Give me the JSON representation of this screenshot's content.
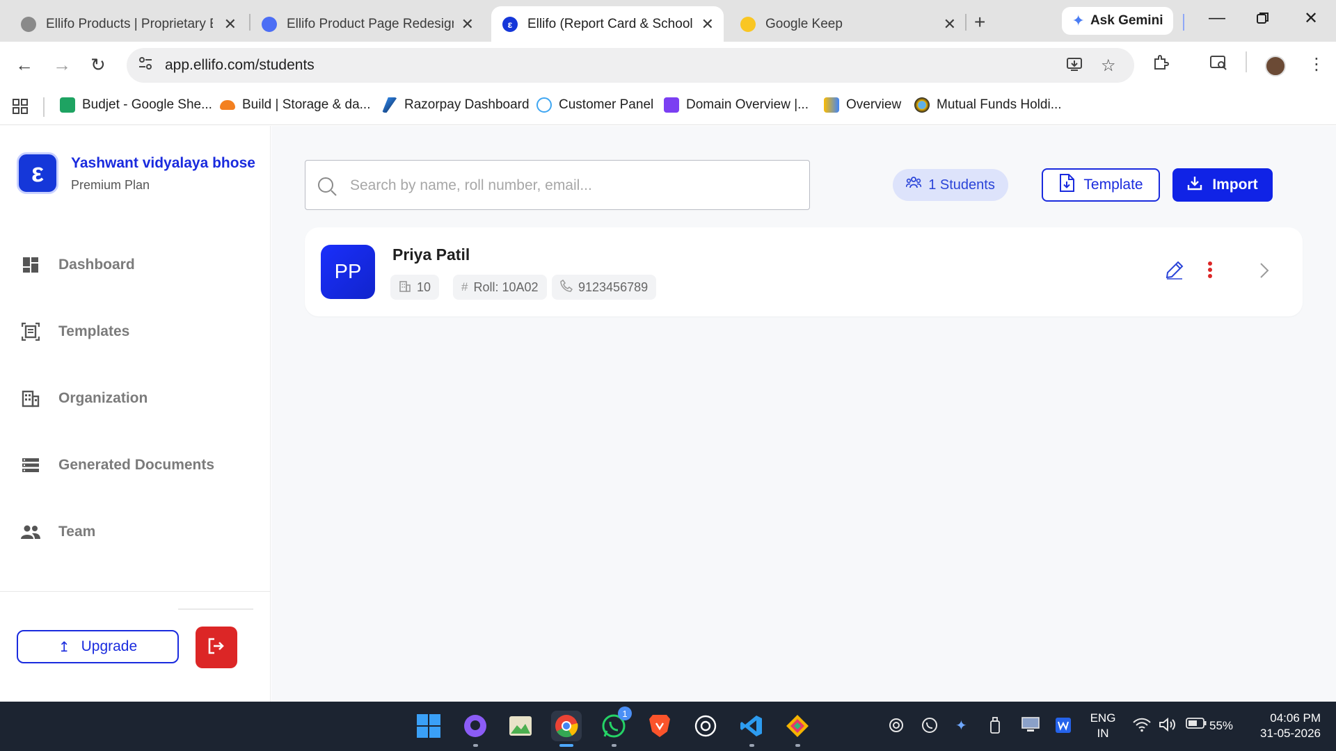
{
  "browser": {
    "tabs": [
      {
        "title": "Ellifo Products | Proprietary En",
        "active": false
      },
      {
        "title": "Ellifo Product Page Redesign -",
        "active": false
      },
      {
        "title": "Ellifo (Report Card & School E",
        "active": true
      },
      {
        "title": "Google Keep",
        "active": false
      }
    ],
    "new_tab": "+",
    "gemini_label": "Ask Gemini",
    "url": "app.ellifo.com/students",
    "bookmarks": [
      {
        "label": "Budjet - Google She...",
        "color": "#1ea362"
      },
      {
        "label": "Build | Storage & da...",
        "color": "#f38020"
      },
      {
        "label": "Razorpay Dashboard",
        "color": "#0c2451"
      },
      {
        "label": "Customer Panel",
        "color": "#3ea6f2"
      },
      {
        "label": "Domain Overview |...",
        "color": "#7b3ff2"
      },
      {
        "label": "Overview",
        "color": "#4285f4"
      },
      {
        "label": "Mutual Funds Holdi...",
        "color": "#222222"
      }
    ]
  },
  "sidebar": {
    "brand_name": "Yashwant vidyalaya bhose",
    "plan": "Premium Plan",
    "items": [
      {
        "label": "Dashboard",
        "icon": "dashboard-icon"
      },
      {
        "label": "Templates",
        "icon": "templates-icon"
      },
      {
        "label": "Organization",
        "icon": "organization-icon"
      },
      {
        "label": "Generated Documents",
        "icon": "documents-icon"
      },
      {
        "label": "Team",
        "icon": "team-icon"
      }
    ],
    "upgrade_label": "Upgrade"
  },
  "main": {
    "search_placeholder": "Search by name, roll number, email...",
    "students_count": "1 Students",
    "template_label": "Template",
    "import_label": "Import",
    "students": [
      {
        "initials": "PP",
        "name": "Priya Patil",
        "class": "10",
        "roll": "Roll: 10A02",
        "phone": "9123456789"
      }
    ]
  },
  "taskbar": {
    "language": "ENG",
    "region": "IN",
    "battery": "55%",
    "time": "04:06 PM",
    "date": "31-05-2026",
    "whatsapp_badge": "1"
  },
  "colors": {
    "brand": "#1a2bde",
    "danger": "#dc2626",
    "pill_bg": "#dde3fb"
  }
}
